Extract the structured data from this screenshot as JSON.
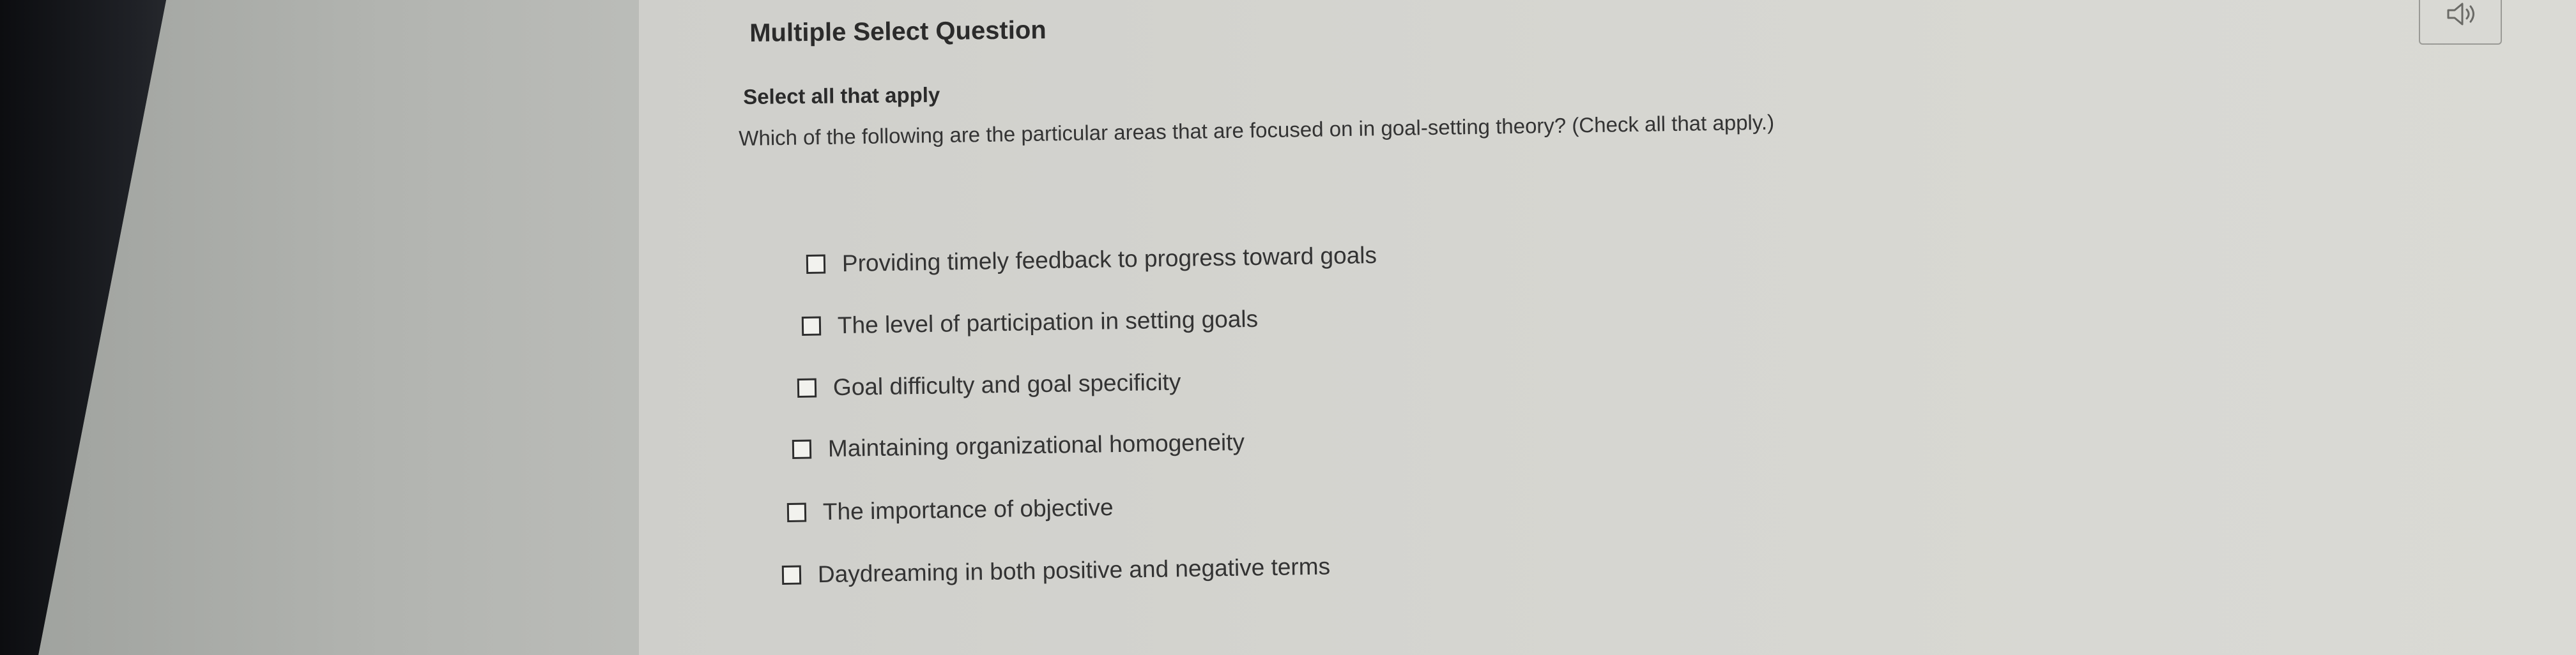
{
  "question": {
    "type_label": "Multiple Select Question",
    "instruction": "Select all that apply",
    "prompt": "Which of the following are the particular areas that are focused on in goal-setting theory? (Check all that apply.)"
  },
  "options": [
    {
      "label": "Providing timely feedback to progress toward goals",
      "checked": false
    },
    {
      "label": "The level of participation in setting goals",
      "checked": false
    },
    {
      "label": "Goal difficulty and goal specificity",
      "checked": false
    },
    {
      "label": "Maintaining organizational homogeneity",
      "checked": false
    },
    {
      "label": "The importance of objective",
      "checked": false
    },
    {
      "label": "Daydreaming in both positive and negative terms",
      "checked": false
    }
  ],
  "toolbar": {
    "audio_icon": "speaker-icon"
  }
}
